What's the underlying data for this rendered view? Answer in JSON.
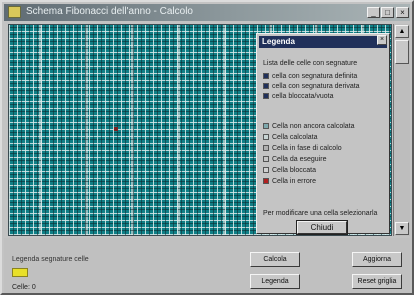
{
  "window": {
    "title": "Schema Fibonacci dell'anno - Calcolo",
    "controls": [
      "_",
      "□",
      "×"
    ]
  },
  "legend": {
    "title": "Legenda",
    "close_glyph": "×",
    "heading": "Lista delle celle con segnature",
    "items_top": [
      {
        "label": "cella con segnatura definita",
        "color": "#20305a"
      },
      {
        "label": "cella con segnatura derivata",
        "color": "#20305a"
      },
      {
        "label": "cella bloccata/vuota",
        "color": "#20305a"
      }
    ],
    "items_bottom": [
      {
        "label": "Cella non ancora calcolata",
        "color": "#7da8ad"
      },
      {
        "label": "Cella calcolata",
        "color": "#c8d4d4"
      },
      {
        "label": "Cella in fase di calcolo",
        "color": "#b0b0b0"
      },
      {
        "label": "Cella da eseguire",
        "color": "#c4c4c4"
      },
      {
        "label": "Cella bloccata",
        "color": "#d0d0d0"
      },
      {
        "label": "Cella in errore",
        "color": "#b02020"
      }
    ],
    "note": "Per modificare una cella selezionarla",
    "close_button": "Chiudi"
  },
  "status": {
    "info": "Legenda segnature celle",
    "count": "Celle: 0"
  },
  "buttons": {
    "calcola": "Calcola",
    "legenda": "Legenda",
    "aggiorna": "Aggiorna",
    "reset": "Reset griglia"
  },
  "colors": {
    "grid_teal": "#0f7f86",
    "selection_yellow": "#e8e02a",
    "titlebar": "#5f6b73"
  }
}
